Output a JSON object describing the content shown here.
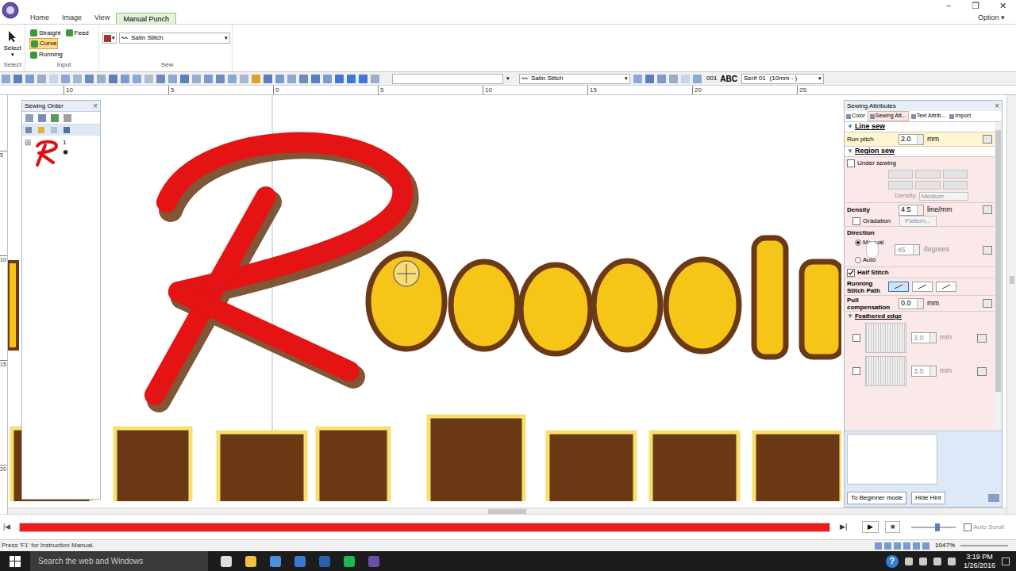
{
  "titlebar": {
    "controls": [
      "−",
      "❐",
      "✕"
    ]
  },
  "tabs": [
    {
      "label": "Home",
      "selected": false
    },
    {
      "label": "Image",
      "selected": false
    },
    {
      "label": "View",
      "selected": false
    },
    {
      "label": "Manual Punch",
      "selected": true
    }
  ],
  "option": {
    "label": "Option",
    "arrow": "▾"
  },
  "ribbon": {
    "select": {
      "label": "Select",
      "arrow": "▾",
      "group": "Select"
    },
    "input": {
      "group": "Input",
      "tools": [
        {
          "label": "Straight",
          "selected": false
        },
        {
          "label": "Feed",
          "selected": false
        },
        {
          "label": "Curve",
          "selected": true
        },
        {
          "label": "Running",
          "selected": false
        }
      ]
    },
    "sew": {
      "group": "Sew",
      "color": "#d41f1f",
      "arrow": "▾",
      "stitch": "Satin Stitch",
      "stitch_arrow": "▾"
    }
  },
  "toolbar": {
    "field_arrow": "▾",
    "stitch": {
      "value": "Satin Stitch",
      "arrow": "▾"
    },
    "number": "001",
    "abc": "ABC",
    "font": {
      "value": "Serif 01",
      "size": "(10mm - )",
      "arrow": "▾"
    }
  },
  "ruler": {
    "h": [
      "10",
      "5",
      "0",
      "5",
      "10",
      "15",
      "20",
      "25"
    ],
    "v": [
      "5",
      "10",
      "15",
      "20"
    ]
  },
  "sewing_order": {
    "title": "Sewing Order",
    "close": "×",
    "items": [
      {
        "number": "1",
        "color": "#e01010",
        "expander": "⊞",
        "selected": false
      }
    ]
  },
  "attributes": {
    "title": "Sewing Attributes",
    "close": "×",
    "tabs": [
      {
        "label": "Color",
        "selected": false
      },
      {
        "label": "Sewing Att...",
        "selected": true
      },
      {
        "label": "Text Attrib...",
        "selected": false
      },
      {
        "label": "Import",
        "selected": false
      }
    ],
    "line_sew": {
      "title": "Line sew",
      "label": "Run pitch",
      "value": "2.0",
      "unit": "mm"
    },
    "region_sew": {
      "title": "Region sew",
      "under_sewing": {
        "label": "Under sewing",
        "checked": false
      },
      "under_density": {
        "label": "Density",
        "value": "Medium",
        "disabled": true
      },
      "density": {
        "label": "Density",
        "value": "4.5",
        "unit": "line/mm"
      },
      "gradation": {
        "label": "Gradation",
        "checked": false,
        "button": "Pattern...",
        "disabled": true
      },
      "direction": {
        "label": "Direction",
        "options": [
          {
            "label": "Manual",
            "selected": true
          },
          {
            "label": "Auto",
            "selected": false
          }
        ],
        "value": "45",
        "unit": "degrees",
        "disabled": true
      },
      "half_stitch": {
        "label": "Half Stitch",
        "checked": true
      },
      "running_path": {
        "label": "Running Stitch Path",
        "options": [
          {
            "selected": true
          },
          {
            "selected": false
          },
          {
            "selected": false
          }
        ]
      },
      "pull": {
        "label": "Pull compensation",
        "value": "0.0",
        "unit": "mm"
      },
      "feathered": {
        "title": "Feathered edge",
        "rows": [
          {
            "checked": false,
            "value": "3.0",
            "unit": "mm",
            "disabled": true
          },
          {
            "checked": false,
            "value": "3.0",
            "unit": "mm",
            "disabled": true
          }
        ]
      }
    },
    "buttons": [
      "To Beginner mode",
      "Hide Hint"
    ]
  },
  "playback": {
    "start": "|◀",
    "end": "▶|",
    "play": "▶",
    "stop": "■",
    "level": 1,
    "color": "#ee1c1c",
    "speed": 0.6,
    "auto_scroll": {
      "label": "Auto Scroll",
      "checked": false,
      "disabled": true
    }
  },
  "status": {
    "message": "Press 'F1' for Instruction Manual.",
    "zoom": "1047%"
  },
  "taskbar": {
    "search": "Search the web and Windows",
    "help": "?",
    "time": "3:19 PM",
    "date": "1/26/2016"
  }
}
